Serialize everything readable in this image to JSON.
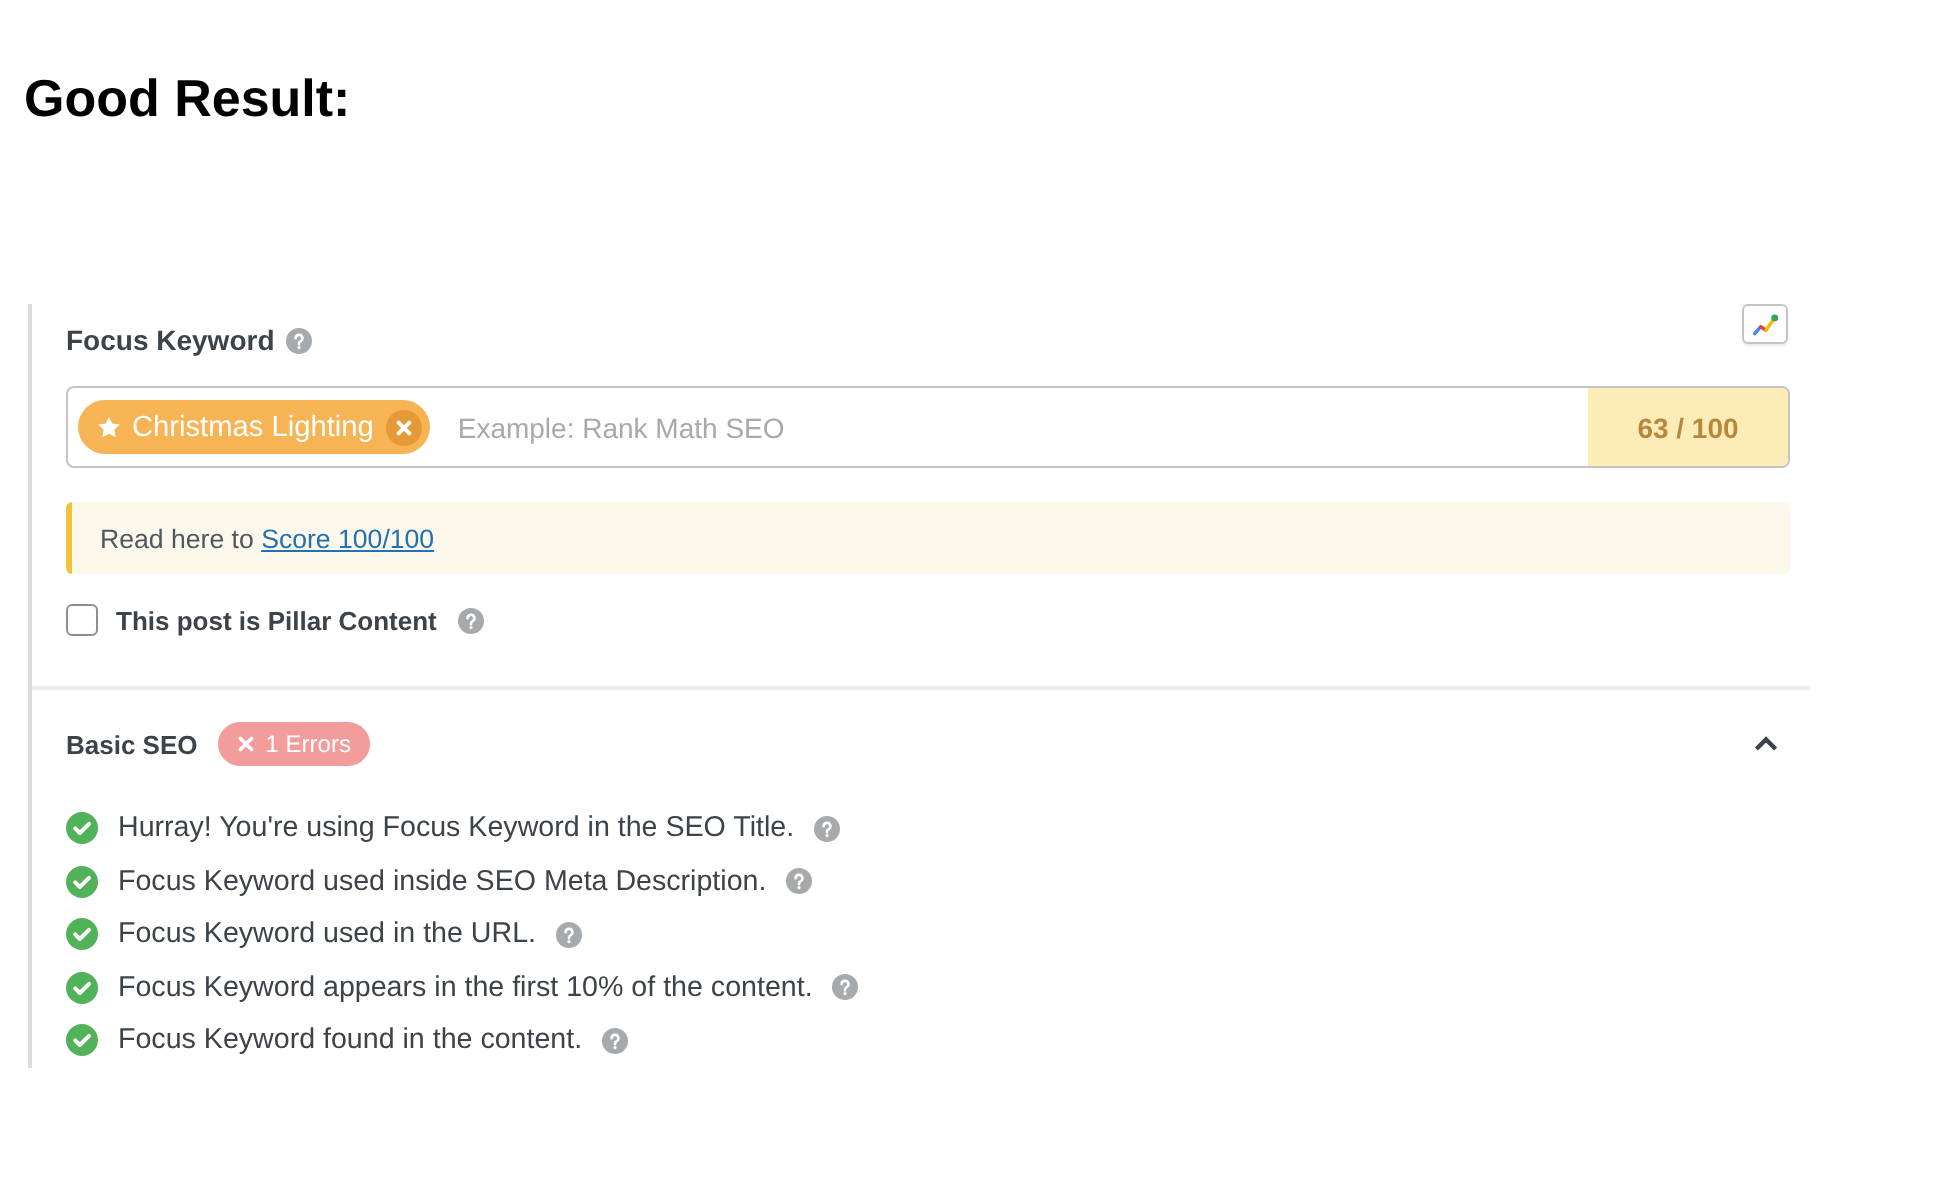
{
  "heading": "Good Result:",
  "focus_keyword": {
    "label": "Focus Keyword",
    "keywords": [
      {
        "text": "Christmas Lighting"
      }
    ],
    "placeholder": "Example: Rank Math SEO",
    "score": "63 / 100"
  },
  "notice": {
    "text": "Read here to",
    "link": "Score 100/100"
  },
  "pillar_content": {
    "label": "This post is Pillar Content",
    "checked": false
  },
  "basic_seo": {
    "title": "Basic SEO",
    "errors": "1 Errors",
    "expanded": true,
    "tests": [
      {
        "text": "Hurray! You're using Focus Keyword in the SEO Title.",
        "passed": true
      },
      {
        "text": "Focus Keyword used inside SEO Meta Description.",
        "passed": true
      },
      {
        "text": "Focus Keyword used in the URL.",
        "passed": true
      },
      {
        "text": "Focus Keyword appears in the first 10% of the content.",
        "passed": true
      },
      {
        "text": "Focus Keyword found in the content.",
        "passed": true
      }
    ]
  }
}
